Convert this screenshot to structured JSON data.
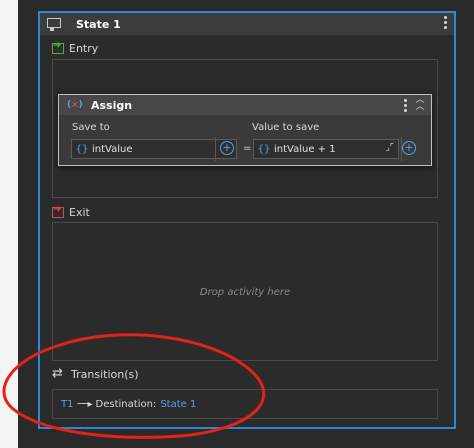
{
  "state": {
    "title": "State 1",
    "entry_label": "Entry",
    "exit_label": "Exit",
    "transitions_label": "Transition(s)",
    "drop_hint": "Drop activity here"
  },
  "assign": {
    "title": "Assign",
    "save_to_label": "Save to",
    "value_to_save_label": "Value to save",
    "save_to_value": "intValue",
    "value_to_save_value": "intValue + 1",
    "brace_glyph": "{}",
    "equals": "="
  },
  "transition": {
    "id": "T1",
    "destination_label": "Destination:",
    "destination_value": "State 1"
  },
  "colors": {
    "accent_blue": "#2f86d6",
    "link_blue": "#5aa0e6",
    "entry_green": "#5aaa3c",
    "exit_red": "#d34a3f",
    "annotation_red": "#e2231a"
  }
}
